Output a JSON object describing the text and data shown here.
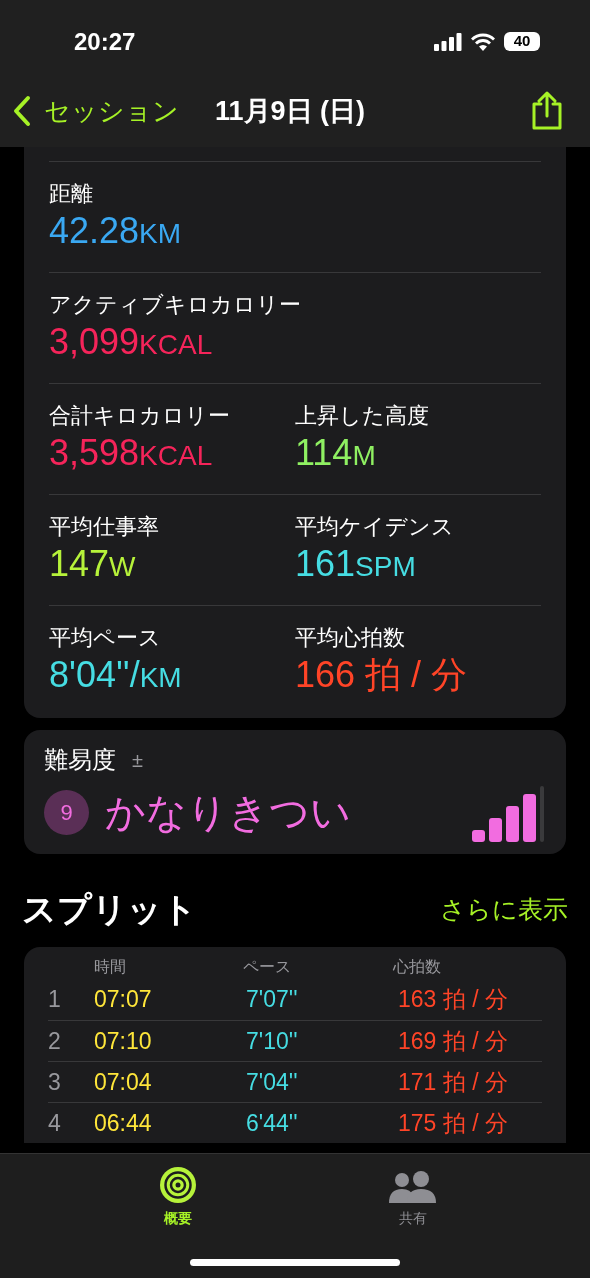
{
  "status_bar": {
    "time": "20:27",
    "battery": "40"
  },
  "nav": {
    "back": "セッション",
    "title": "11月9日 (日)"
  },
  "metrics": [
    {
      "cells": [
        {
          "label": "距離",
          "value": "42.28",
          "unit": "KM",
          "color": "#3aa8f2"
        }
      ]
    },
    {
      "cells": [
        {
          "label": "アクティブキロカロリー",
          "value": "3,099",
          "unit": "KCAL",
          "color": "#f5245a"
        }
      ]
    },
    {
      "cells": [
        {
          "label": "合計キロカロリー",
          "value": "3,598",
          "unit": "KCAL",
          "color": "#f5245a"
        },
        {
          "label": "上昇した高度",
          "value": "114",
          "unit": "M",
          "color": "#8ff062"
        }
      ]
    },
    {
      "cells": [
        {
          "label": "平均仕事率",
          "value": "147",
          "unit": "W",
          "color": "#b6f23a"
        },
        {
          "label": "平均ケイデンス",
          "value": "161",
          "unit": "SPM",
          "color": "#46dde3"
        }
      ]
    },
    {
      "cells": [
        {
          "label": "平均ペース",
          "value": "8'04''/",
          "unit": "KM",
          "color": "#46dde3"
        },
        {
          "label": "平均心拍数",
          "value": "166 拍 / 分",
          "color": "#ff4427"
        }
      ]
    }
  ],
  "difficulty": {
    "label": "難易度",
    "adjust": "±",
    "score": "9",
    "text": "かなりきつい",
    "level": 0.8
  },
  "splits": {
    "title": "スプリット",
    "more": "さらに表示",
    "columns": [
      "時間",
      "ペース",
      "心拍数"
    ],
    "rows": [
      {
        "index": "1",
        "time": "07:07",
        "pace": "7'07''",
        "heart_rate": "163 拍 / 分"
      },
      {
        "index": "2",
        "time": "07:10",
        "pace": "7'10''",
        "heart_rate": "169 拍 / 分"
      },
      {
        "index": "3",
        "time": "07:04",
        "pace": "7'04''",
        "heart_rate": "171 拍 / 分"
      },
      {
        "index": "4",
        "time": "06:44",
        "pace": "6'44''",
        "heart_rate": "175 拍 / 分"
      }
    ]
  },
  "tab_bar": [
    {
      "kind": "rings",
      "label": "概要",
      "selected": true
    },
    {
      "kind": "people",
      "label": "共有",
      "selected": false
    }
  ]
}
